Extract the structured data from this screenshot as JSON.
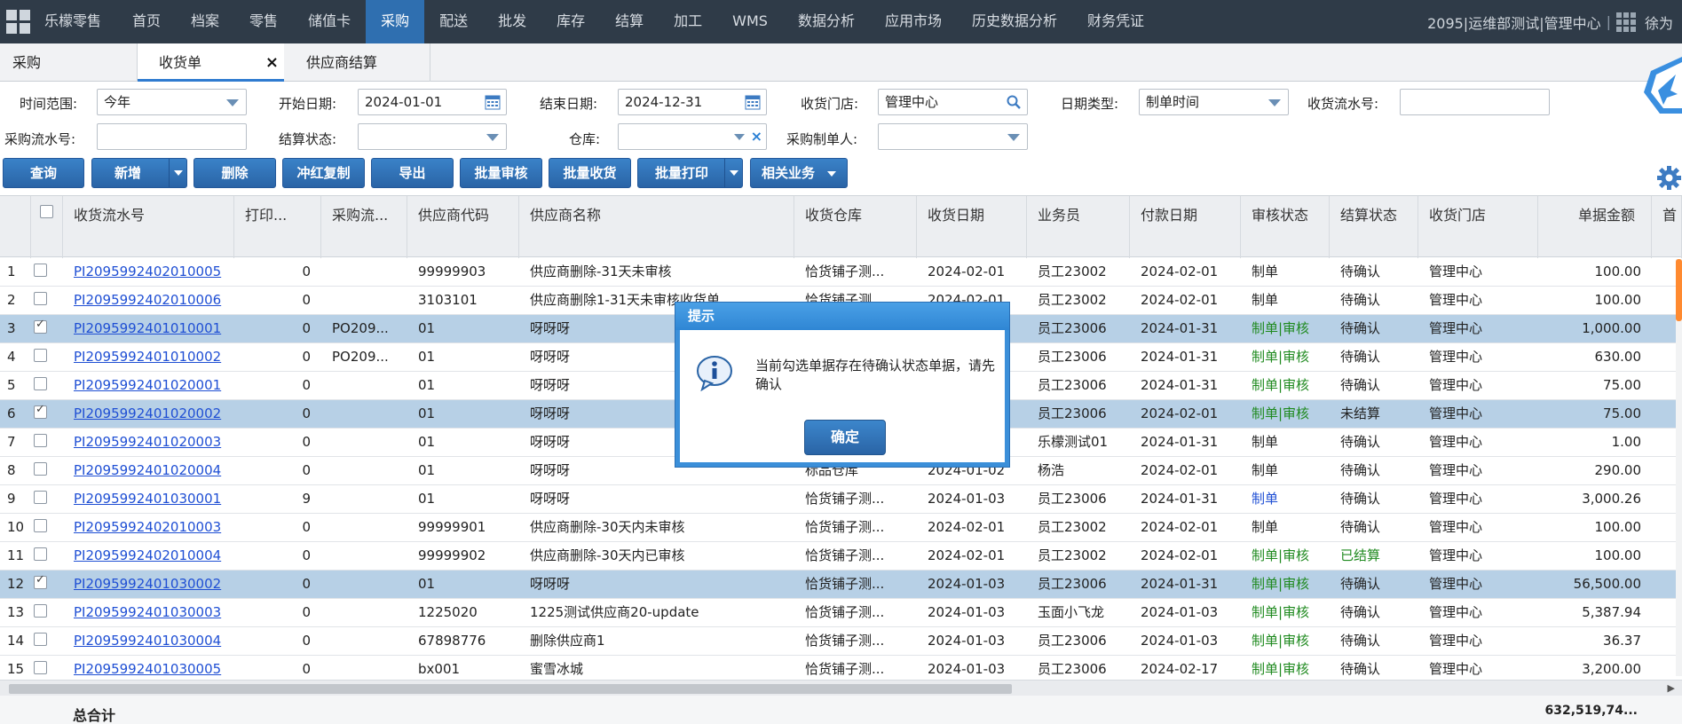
{
  "nav": {
    "brand": "乐檬零售",
    "items": [
      "首页",
      "档案",
      "零售",
      "储值卡",
      "采购",
      "配送",
      "批发",
      "库存",
      "结算",
      "加工",
      "WMS",
      "数据分析",
      "应用市场",
      "历史数据分析",
      "财务凭证"
    ],
    "active": "采购",
    "org": "2095|运维部测试|管理中心",
    "user": "徐为"
  },
  "tabs": [
    {
      "label": "采购"
    },
    {
      "label": "收货单",
      "active": true
    },
    {
      "label": "供应商结算"
    }
  ],
  "filters": {
    "time_range_label": "时间范围:",
    "time_range_value": "今年",
    "start_date_label": "开始日期:",
    "start_date_value": "2024-01-01",
    "end_date_label": "结束日期:",
    "end_date_value": "2024-12-31",
    "store_label": "收货门店:",
    "store_value": "管理中心",
    "date_type_label": "日期类型:",
    "date_type_value": "制单时间",
    "receipt_no_label": "收货流水号:",
    "receipt_no_value": "",
    "po_no_label": "采购流水号:",
    "po_no_value": "",
    "settle_status_label": "结算状态:",
    "settle_status_value": "",
    "warehouse_label": "仓库:",
    "warehouse_value": "",
    "po_creator_label": "采购制单人:",
    "po_creator_value": ""
  },
  "toolbar": {
    "query": "查询",
    "add": "新增",
    "delete": "删除",
    "red_copy": "冲红复制",
    "export": "导出",
    "batch_audit": "批量审核",
    "batch_receive": "批量收货",
    "batch_print": "批量打印",
    "related": "相关业务"
  },
  "columns": [
    "收货流水号",
    "打印...",
    "采购流...",
    "供应商代码",
    "供应商名称",
    "收货仓库",
    "收货日期",
    "业务员",
    "付款日期",
    "审核状态",
    "结算状态",
    "收货门店",
    "单据金额",
    "首"
  ],
  "rows": [
    {
      "n": "1",
      "checked": false,
      "no": "PI2095992402010005",
      "print": "0",
      "po": "",
      "sup_code": "99999903",
      "sup_name": "供应商删除-31天未审核",
      "wh": "恰货铺子测...",
      "date": "2024-02-01",
      "staff": "员工23002",
      "pay": "2024-02-01",
      "audit": "制单",
      "audit_style": "plain",
      "settle": "待确认",
      "settle_style": "plain",
      "store": "管理中心",
      "amount": "100.00"
    },
    {
      "n": "2",
      "checked": false,
      "no": "PI2095992402010006",
      "print": "0",
      "po": "",
      "sup_code": "3103101",
      "sup_name": "供应商删除1-31天未审核收货单",
      "wh": "恰货铺子测...",
      "date": "2024-02-01",
      "staff": "员工23002",
      "pay": "2024-02-01",
      "audit": "制单",
      "audit_style": "plain",
      "settle": "待确认",
      "settle_style": "plain",
      "store": "管理中心",
      "amount": "100.00"
    },
    {
      "n": "3",
      "checked": true,
      "no": "PI2095992401010001",
      "print": "0",
      "po": "PO209...",
      "sup_code": "01",
      "sup_name": "呀呀呀",
      "wh": "",
      "date": "",
      "staff": "员工23006",
      "pay": "2024-01-31",
      "audit": "制单|审核",
      "audit_style": "green",
      "settle": "待确认",
      "settle_style": "plain",
      "store": "管理中心",
      "amount": "1,000.00"
    },
    {
      "n": "4",
      "checked": false,
      "no": "PI2095992401010002",
      "print": "0",
      "po": "PO209...",
      "sup_code": "01",
      "sup_name": "呀呀呀",
      "wh": "",
      "date": "",
      "staff": "员工23006",
      "pay": "2024-01-31",
      "audit": "制单|审核",
      "audit_style": "green",
      "settle": "待确认",
      "settle_style": "plain",
      "store": "管理中心",
      "amount": "630.00"
    },
    {
      "n": "5",
      "checked": false,
      "no": "PI2095992401020001",
      "print": "0",
      "po": "",
      "sup_code": "01",
      "sup_name": "呀呀呀",
      "wh": "",
      "date": "",
      "staff": "员工23006",
      "pay": "2024-01-31",
      "audit": "制单|审核",
      "audit_style": "green",
      "settle": "待确认",
      "settle_style": "plain",
      "store": "管理中心",
      "amount": "75.00"
    },
    {
      "n": "6",
      "checked": true,
      "no": "PI2095992401020002",
      "print": "0",
      "po": "",
      "sup_code": "01",
      "sup_name": "呀呀呀",
      "wh": "",
      "date": "",
      "staff": "员工23006",
      "pay": "2024-02-01",
      "audit": "制单|审核",
      "audit_style": "green",
      "settle": "未结算",
      "settle_style": "plain",
      "store": "管理中心",
      "amount": "75.00"
    },
    {
      "n": "7",
      "checked": false,
      "no": "PI2095992401020003",
      "print": "0",
      "po": "",
      "sup_code": "01",
      "sup_name": "呀呀呀",
      "wh": "",
      "date": "",
      "staff": "乐檬测试01",
      "pay": "2024-01-31",
      "audit": "制单",
      "audit_style": "plain",
      "settle": "待确认",
      "settle_style": "plain",
      "store": "管理中心",
      "amount": "1.00"
    },
    {
      "n": "8",
      "checked": false,
      "no": "PI2095992401020004",
      "print": "0",
      "po": "",
      "sup_code": "01",
      "sup_name": "呀呀呀",
      "wh": "标品仓库",
      "date": "2024-01-02",
      "staff": "杨浩",
      "pay": "2024-02-01",
      "audit": "制单",
      "audit_style": "plain",
      "settle": "待确认",
      "settle_style": "plain",
      "store": "管理中心",
      "amount": "290.00"
    },
    {
      "n": "9",
      "checked": false,
      "no": "PI2095992401030001",
      "print": "9",
      "po": "",
      "sup_code": "01",
      "sup_name": "呀呀呀",
      "wh": "恰货铺子测...",
      "date": "2024-01-03",
      "staff": "员工23006",
      "pay": "2024-01-31",
      "audit": "制单",
      "audit_style": "blue",
      "settle": "待确认",
      "settle_style": "plain",
      "store": "管理中心",
      "amount": "3,000.26"
    },
    {
      "n": "10",
      "checked": false,
      "no": "PI2095992402010003",
      "print": "0",
      "po": "",
      "sup_code": "99999901",
      "sup_name": "供应商删除-30天内未审核",
      "wh": "恰货铺子测...",
      "date": "2024-02-01",
      "staff": "员工23002",
      "pay": "2024-02-01",
      "audit": "制单",
      "audit_style": "plain",
      "settle": "待确认",
      "settle_style": "plain",
      "store": "管理中心",
      "amount": "100.00"
    },
    {
      "n": "11",
      "checked": false,
      "no": "PI2095992402010004",
      "print": "0",
      "po": "",
      "sup_code": "99999902",
      "sup_name": "供应商删除-30天内已审核",
      "wh": "恰货铺子测...",
      "date": "2024-02-01",
      "staff": "员工23002",
      "pay": "2024-02-01",
      "audit": "制单|审核",
      "audit_style": "green",
      "settle": "已结算",
      "settle_style": "green",
      "store": "管理中心",
      "amount": "100.00"
    },
    {
      "n": "12",
      "checked": true,
      "no": "PI2095992401030002",
      "print": "0",
      "po": "",
      "sup_code": "01",
      "sup_name": "呀呀呀",
      "wh": "恰货铺子测...",
      "date": "2024-01-03",
      "staff": "员工23006",
      "pay": "2024-01-31",
      "audit": "制单|审核",
      "audit_style": "green",
      "settle": "待确认",
      "settle_style": "plain",
      "store": "管理中心",
      "amount": "56,500.00"
    },
    {
      "n": "13",
      "checked": false,
      "no": "PI2095992401030003",
      "print": "0",
      "po": "",
      "sup_code": "1225020",
      "sup_name": "1225测试供应商20-update",
      "wh": "恰货铺子测...",
      "date": "2024-01-03",
      "staff": "玉面小飞龙",
      "pay": "2024-01-03",
      "audit": "制单|审核",
      "audit_style": "green",
      "settle": "待确认",
      "settle_style": "plain",
      "store": "管理中心",
      "amount": "5,387.94"
    },
    {
      "n": "14",
      "checked": false,
      "no": "PI2095992401030004",
      "print": "0",
      "po": "",
      "sup_code": "67898776",
      "sup_name": "删除供应商1",
      "wh": "恰货铺子测...",
      "date": "2024-01-03",
      "staff": "员工23006",
      "pay": "2024-01-03",
      "audit": "制单|审核",
      "audit_style": "green",
      "settle": "待确认",
      "settle_style": "plain",
      "store": "管理中心",
      "amount": "36.37"
    },
    {
      "n": "15",
      "checked": false,
      "no": "PI2095992401030005",
      "print": "0",
      "po": "",
      "sup_code": "bx001",
      "sup_name": "蜜雪冰城",
      "wh": "恰货铺子测...",
      "date": "2024-01-03",
      "staff": "员工23006",
      "pay": "2024-02-17",
      "audit": "制单|审核",
      "audit_style": "green",
      "settle": "待确认",
      "settle_style": "plain",
      "store": "管理中心",
      "amount": "3,200.00"
    }
  ],
  "footer": {
    "total_label": "总合计",
    "total_amount": "632,519,74..."
  },
  "dialog": {
    "title": "提示",
    "message": "当前勾选单据存在待确认状态单据，请先确认",
    "ok": "确定"
  },
  "colors": {
    "nav_bg": "#2f3b48",
    "nav_active": "#2f6fb0",
    "button": "#2f6cb0",
    "selected_row": "#b7d0e6",
    "green_status": "#1f8a1f",
    "link": "#1f4fd4"
  }
}
